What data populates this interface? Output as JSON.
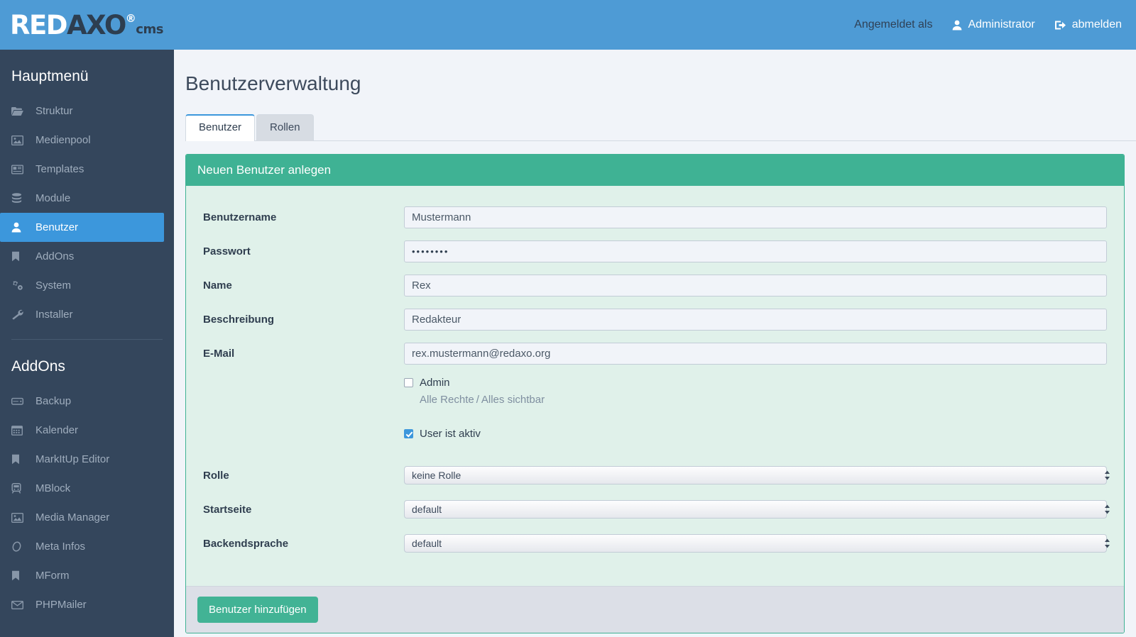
{
  "header": {
    "logo_red": "RED",
    "logo_axo": "AXO",
    "logo_reg": "®",
    "logo_cms": "cms",
    "logged_in_label": "Angemeldet als",
    "user_name": "Administrator",
    "logout_label": "abmelden"
  },
  "sidebar": {
    "main_title": "Hauptmenü",
    "addons_title": "AddOns",
    "main_items": [
      {
        "label": "Struktur",
        "icon": "folder-open-icon",
        "active": false
      },
      {
        "label": "Medienpool",
        "icon": "image-icon",
        "active": false
      },
      {
        "label": "Templates",
        "icon": "newspaper-icon",
        "active": false
      },
      {
        "label": "Module",
        "icon": "database-icon",
        "active": false
      },
      {
        "label": "Benutzer",
        "icon": "user-icon",
        "active": true
      },
      {
        "label": "AddOns",
        "icon": "bookmark-icon",
        "active": false
      },
      {
        "label": "System",
        "icon": "gears-icon",
        "active": false
      },
      {
        "label": "Installer",
        "icon": "wrench-icon",
        "active": false
      }
    ],
    "addon_items": [
      {
        "label": "Backup",
        "icon": "hdd-icon"
      },
      {
        "label": "Kalender",
        "icon": "calendar-icon"
      },
      {
        "label": "MarkItUp Editor",
        "icon": "bookmark-icon"
      },
      {
        "label": "MBlock",
        "icon": "train-icon"
      },
      {
        "label": "Media Manager",
        "icon": "image-icon"
      },
      {
        "label": "Meta Infos",
        "icon": "circle-icon"
      },
      {
        "label": "MForm",
        "icon": "bookmark-icon"
      },
      {
        "label": "PHPMailer",
        "icon": "envelope-icon"
      }
    ]
  },
  "main": {
    "page_title": "Benutzerverwaltung",
    "tabs": [
      {
        "label": "Benutzer",
        "active": true
      },
      {
        "label": "Rollen",
        "active": false
      }
    ],
    "panel_title": "Neuen Benutzer anlegen",
    "fields": {
      "username": {
        "label": "Benutzername",
        "value": "Mustermann"
      },
      "password": {
        "label": "Passwort",
        "value": "••••••••"
      },
      "name": {
        "label": "Name",
        "value": "Rex"
      },
      "description": {
        "label": "Beschreibung",
        "value": "Redakteur"
      },
      "email": {
        "label": "E-Mail",
        "value": "rex.mustermann@redaxo.org"
      },
      "role": {
        "label": "Rolle",
        "value": "keine Rolle"
      },
      "startpage": {
        "label": "Startseite",
        "value": "default"
      },
      "language": {
        "label": "Backendsprache",
        "value": "default"
      }
    },
    "admin_checkbox": {
      "label": "Admin",
      "checked": false
    },
    "admin_sub_left": "Alle Rechte",
    "admin_sub_sep": "/",
    "admin_sub_right": "Alles sichtbar",
    "active_checkbox": {
      "label": "User ist aktiv",
      "checked": true
    },
    "submit_label": "Benutzer hinzufügen"
  },
  "colors": {
    "header_blue": "#4e9bd5",
    "sidebar_dark": "#34465c",
    "active_blue": "#3c97dc",
    "panel_green": "#3fb294",
    "panel_body_mint": "#e0f1ea",
    "content_bg": "#f1f4f9"
  }
}
